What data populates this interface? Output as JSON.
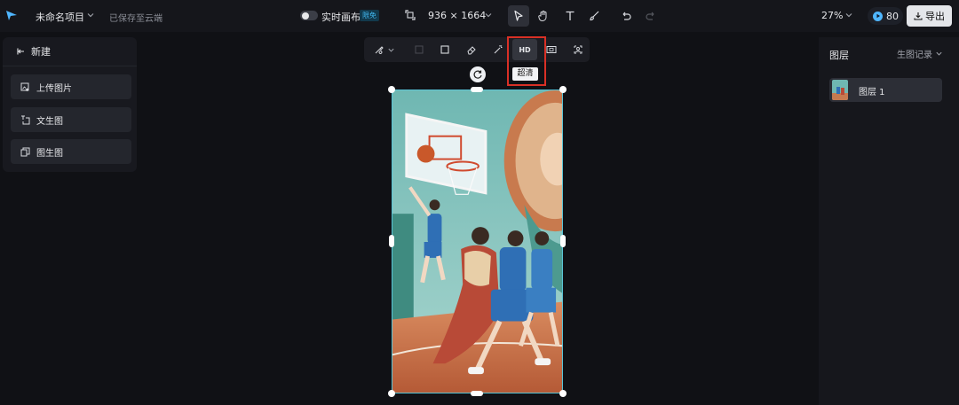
{
  "header": {
    "project_name": "未命名项目",
    "save_status": "已保存至云端",
    "realtime_canvas_label": "实时画布",
    "realtime_badge": "限免",
    "canvas_size": "936 × 1664",
    "zoom": "27%",
    "credits": "80",
    "export_label": "导出"
  },
  "left_panel": {
    "title": "新建",
    "items": [
      {
        "label": "上传图片",
        "icon": "upload-image-icon"
      },
      {
        "label": "文生图",
        "icon": "text-to-image-icon"
      },
      {
        "label": "图生图",
        "icon": "image-to-image-icon"
      }
    ]
  },
  "right_panel": {
    "title": "图层",
    "history_label": "生图记录",
    "layers": [
      {
        "name": "图层 1"
      }
    ]
  },
  "float_toolbar": {
    "hd_label": "HD",
    "hd_tooltip": "超清"
  },
  "colors": {
    "accent": "#41b8f0",
    "highlight": "#d93026",
    "selection": "#59c4d6"
  }
}
